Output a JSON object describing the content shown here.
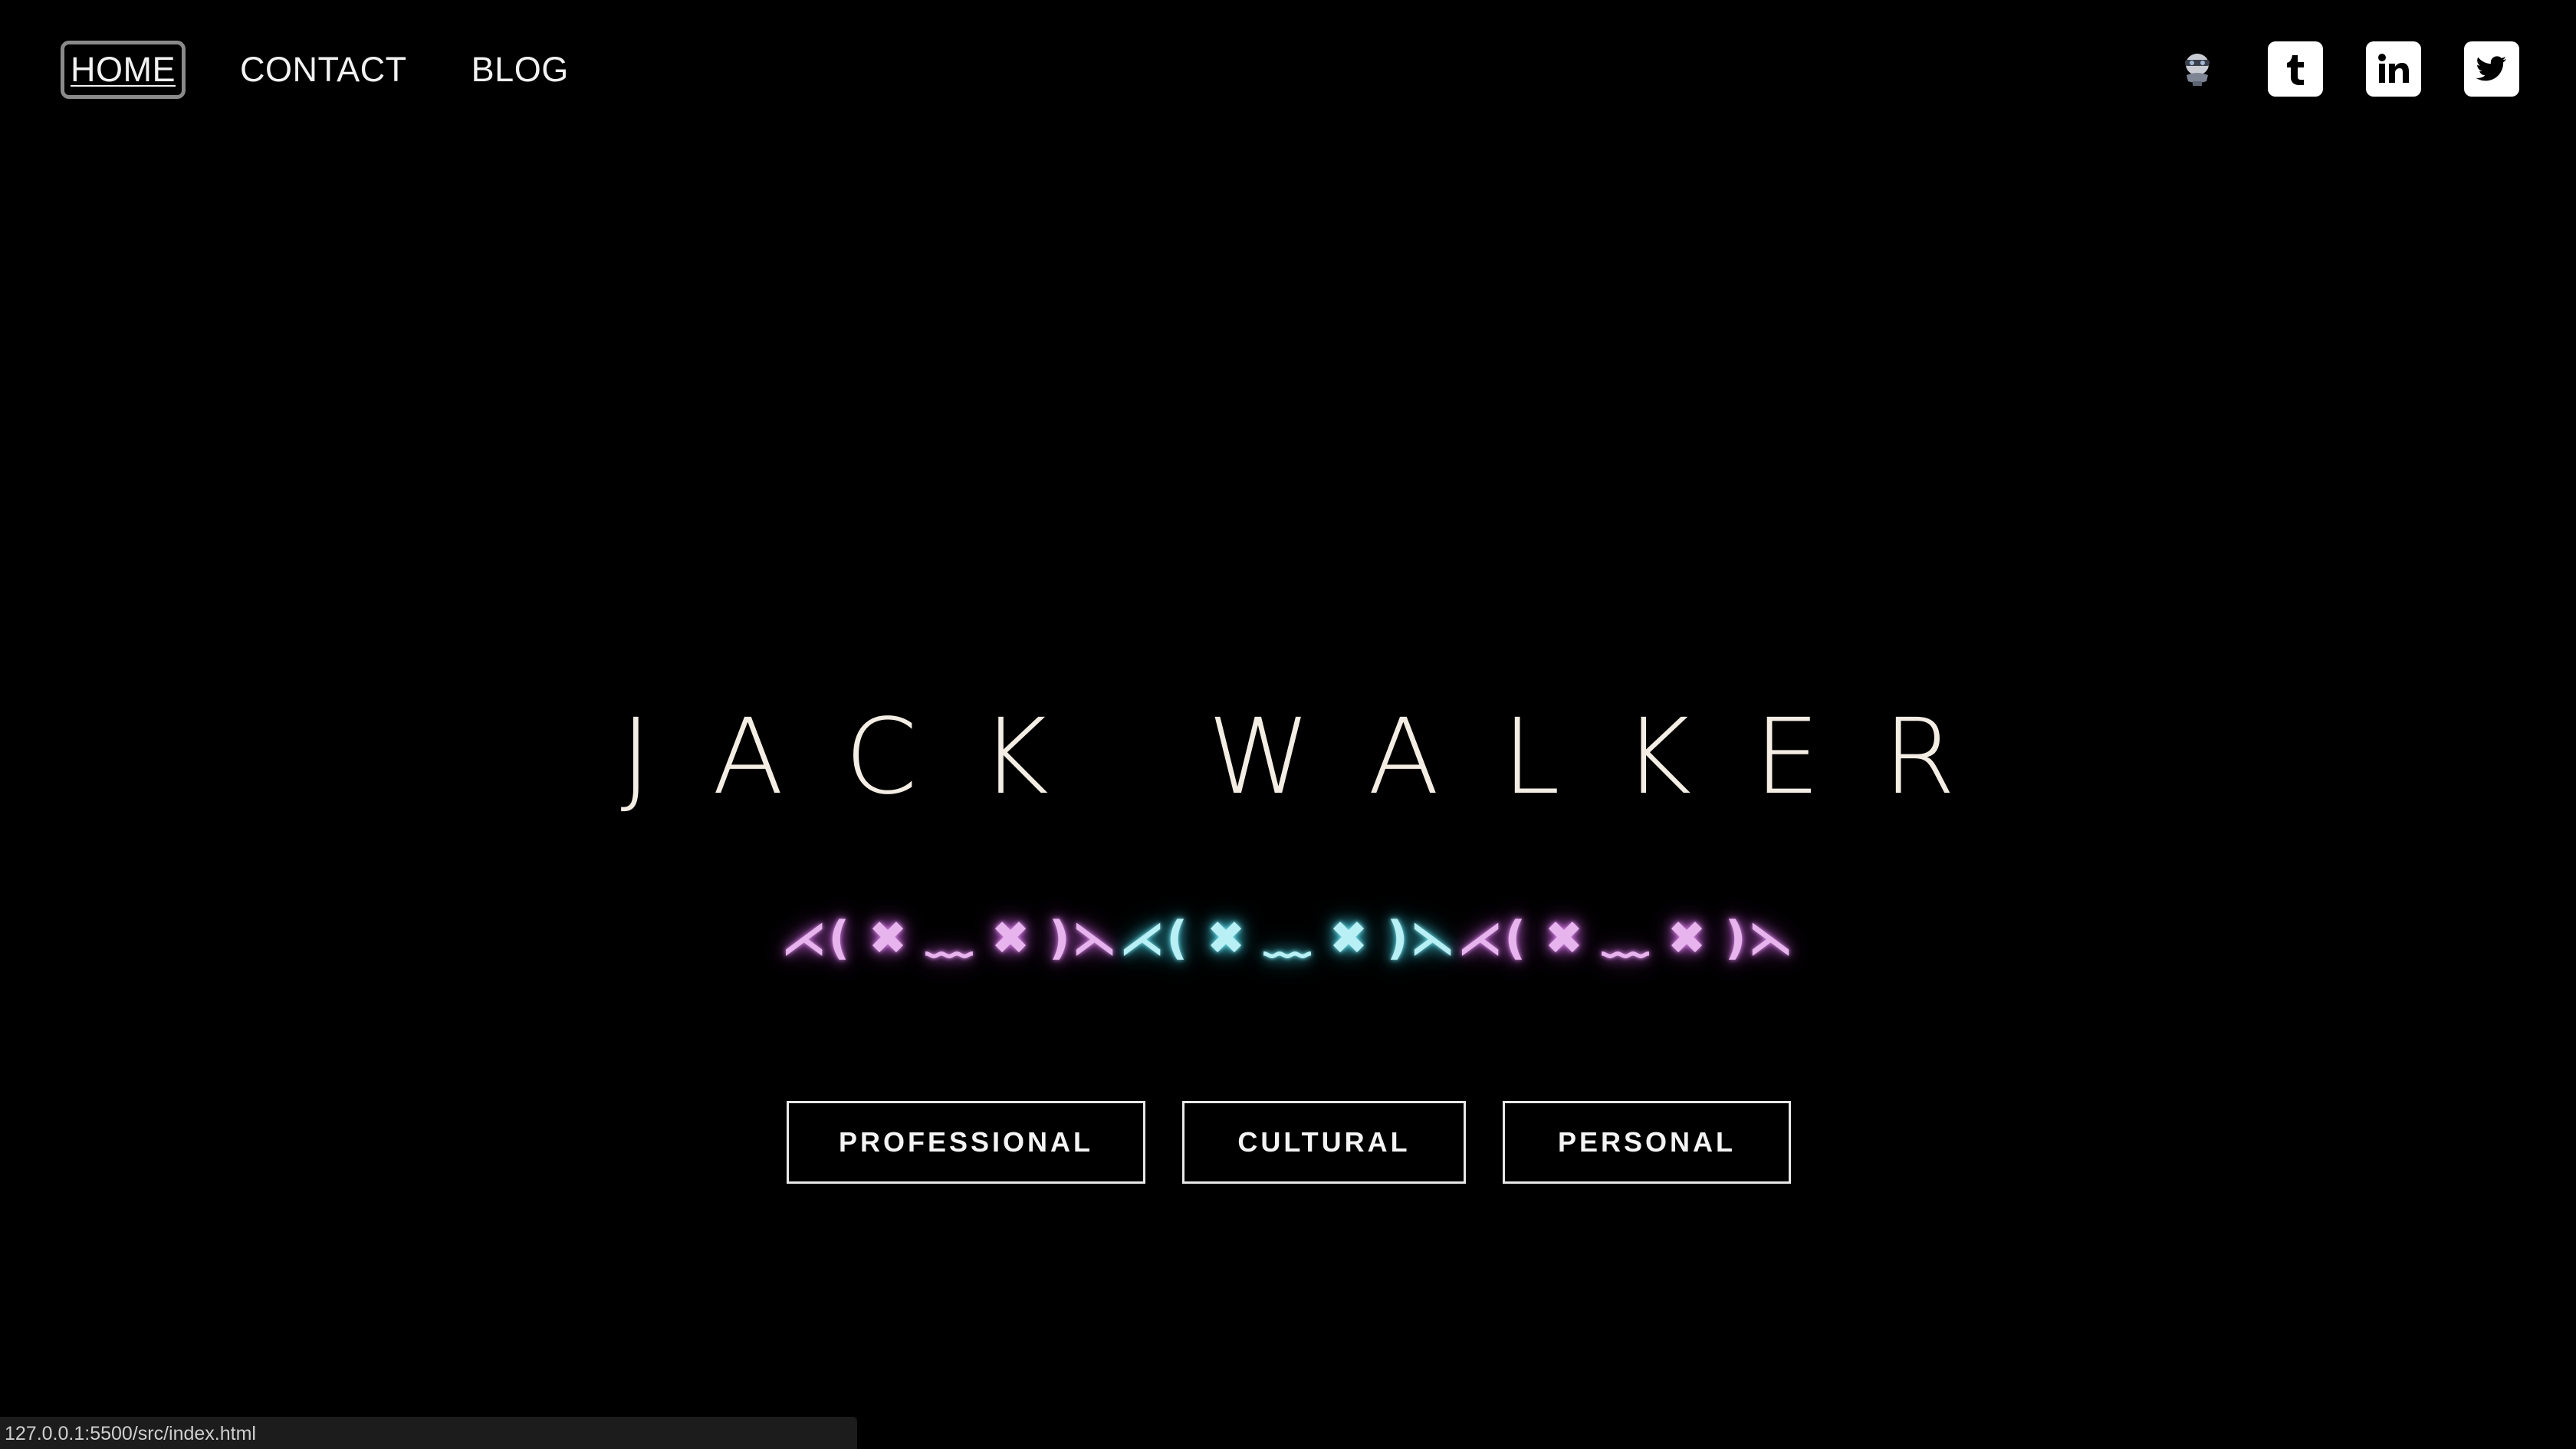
{
  "nav": {
    "items": [
      {
        "label": "HOME",
        "active": true
      },
      {
        "label": "CONTACT",
        "active": false
      },
      {
        "label": "BLOG",
        "active": false
      }
    ]
  },
  "socials": {
    "icons": [
      "skull-avatar-icon",
      "tumblr-icon",
      "linkedin-icon",
      "twitter-icon"
    ]
  },
  "hero": {
    "name": "JACK WALKER",
    "kaomoji": [
      {
        "text": "⋌( ✖ ﹏ ✖ )⋋",
        "color": "#e8b4ee"
      },
      {
        "text": "⋌( ✖ ﹏ ✖ )⋋",
        "color": "#b8f0f5"
      },
      {
        "text": "⋌( ✖ ﹏ ✖ )⋋",
        "color": "#e8b4ee"
      }
    ]
  },
  "buttons": {
    "professional": "PROFESSIONAL",
    "cultural": "CULTURAL",
    "personal": "PERSONAL"
  },
  "status_bar": {
    "url": "127.0.0.1:5500/src/index.html"
  },
  "colors": {
    "background": "#000000",
    "text": "#f3ede4",
    "neon_pink": "#e8b4ee",
    "neon_cyan": "#b8f0f5"
  }
}
